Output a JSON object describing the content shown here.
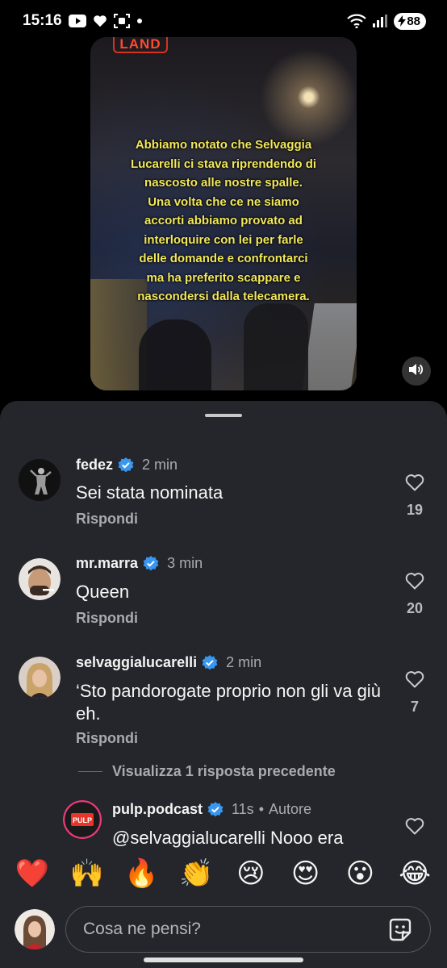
{
  "status_bar": {
    "time": "15:16",
    "battery": "88",
    "left_icons": [
      "youtube-icon",
      "heart-icon",
      "screenshot-icon",
      "dot-icon"
    ],
    "right_icons": [
      "wifi-icon",
      "signal-icon",
      "battery-icon"
    ]
  },
  "video": {
    "logo_text": "LAND",
    "caption": "Abbiamo notato che Selvaggia\nLucarelli ci stava riprendendo di\nnascosto alle nostre spalle.\nUna volta che ce ne siamo\naccorti abbiamo provato ad\ninterloquire con lei per farle\ndelle domande e confrontarci\nma ha preferito scappare e\nnascondersi dalla telecamera.",
    "mute_icon": "speaker-icon"
  },
  "comments": [
    {
      "username": "fedez",
      "time": "2 min",
      "text": "Sei stata nominata",
      "reply_label": "Rispondi",
      "likes": "19"
    },
    {
      "username": "mr.marra",
      "time": "3 min",
      "text": "Queen",
      "reply_label": "Rispondi",
      "likes": "20"
    },
    {
      "username": "selvaggialucarelli",
      "time": "2 min",
      "text": "‘Sto pandorogate proprio non gli va giù eh.",
      "reply_label": "Rispondi",
      "likes": "7"
    }
  ],
  "show_replies": "Visualizza 1 risposta precedente",
  "reply": {
    "username": "pulp.podcast",
    "time": "11s",
    "separator": "•",
    "author_tag": "Autore",
    "text": "@selvaggialucarelli Nooo era",
    "avatar_text": "PULP"
  },
  "emojis": [
    "❤️",
    "🙌",
    "🔥",
    "👏",
    "😢",
    "😍",
    "😮",
    "😂"
  ],
  "input": {
    "placeholder": "Cosa ne pensi?"
  },
  "colors": {
    "sheet_bg": "#24262b",
    "verified_blue": "#3897f0",
    "caption_yellow": "#f2e85a",
    "muted_text": "#a9abb0"
  }
}
